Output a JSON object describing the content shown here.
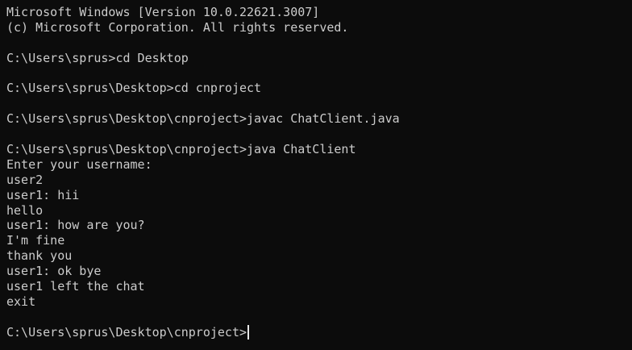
{
  "terminal": {
    "lines": [
      "Microsoft Windows [Version 10.0.22621.3007]",
      "(c) Microsoft Corporation. All rights reserved.",
      "",
      "C:\\Users\\sprus>cd Desktop",
      "",
      "C:\\Users\\sprus\\Desktop>cd cnproject",
      "",
      "C:\\Users\\sprus\\Desktop\\cnproject>javac ChatClient.java",
      "",
      "C:\\Users\\sprus\\Desktop\\cnproject>java ChatClient",
      "Enter your username:",
      "user2",
      "user1: hii",
      "hello",
      "user1: how are you?",
      "I'm fine",
      "thank you",
      "user1: ok bye",
      "user1 left the chat",
      "exit",
      "",
      "C:\\Users\\sprus\\Desktop\\cnproject>"
    ]
  },
  "colors": {
    "background": "#0c0c0c",
    "foreground": "#cccccc",
    "cursor": "#e8e8e8"
  }
}
